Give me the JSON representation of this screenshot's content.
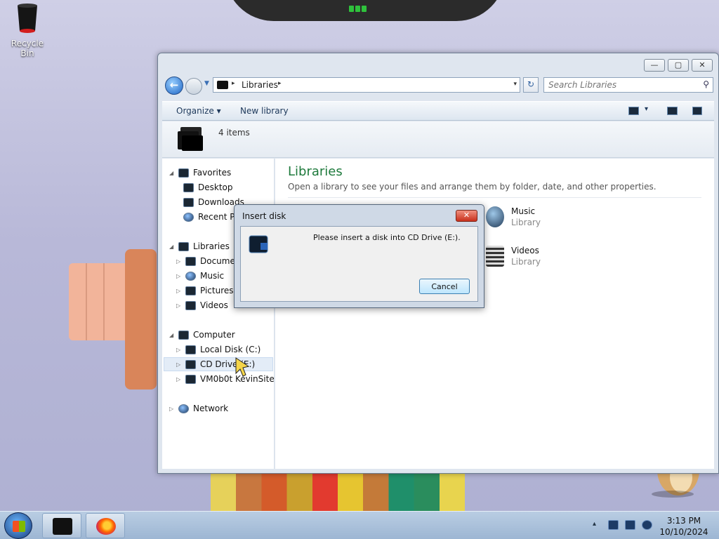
{
  "desktop": {
    "recycle_bin_label": "Recycle Bin"
  },
  "window": {
    "minimize_glyph": "—",
    "maximize_glyph": "▢",
    "close_glyph": "✕",
    "address": {
      "crumb": "Libraries",
      "chevron": "▸",
      "dropdown": "▾"
    },
    "refresh_glyph": "↻",
    "search": {
      "placeholder": "Search Libraries",
      "icon": "magnifier-icon"
    },
    "toolbar": {
      "organize_label": "Organize",
      "organize_arrow": "▾",
      "new_library_label": "New library",
      "view_arrow": "▾"
    },
    "details": {
      "item_count": "4 items"
    },
    "nav_pane": {
      "favorites": {
        "label": "Favorites",
        "items": [
          "Desktop",
          "Downloads",
          "Recent Places"
        ]
      },
      "libraries": {
        "label": "Libraries",
        "items": [
          "Documents",
          "Music",
          "Pictures",
          "Videos"
        ]
      },
      "computer": {
        "label": "Computer",
        "items": [
          "Local Disk (C:)",
          "CD Drive (E:)",
          "VM0b0t KevinSite"
        ]
      },
      "network": {
        "label": "Network"
      }
    },
    "content": {
      "heading": "Libraries",
      "subheading": "Open a library to see your files and arrange them by folder, date, and other properties.",
      "items": [
        {
          "name": "Music",
          "type": "Library"
        },
        {
          "name": "Videos",
          "type": "Library"
        }
      ]
    }
  },
  "dialog": {
    "title": "Insert disk",
    "close_glyph": "✕",
    "message": "Please insert a disk into CD Drive (E:).",
    "cancel_label": "Cancel"
  },
  "taskbar": {
    "tray_arrow": "▴",
    "clock_time": "3:13 PM",
    "clock_date": "10/10/2024"
  },
  "colors": {
    "accent_heading": "#1e7a3c",
    "close_red": "#c8301c",
    "taskbar": "#9db6d3"
  }
}
